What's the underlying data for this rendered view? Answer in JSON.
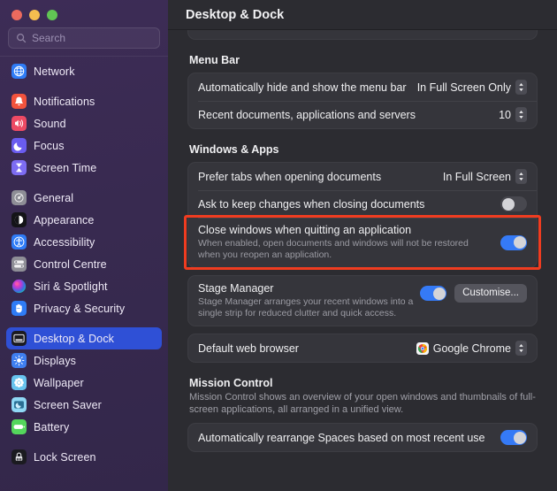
{
  "window": {
    "traffic_lights": [
      "close",
      "minimize",
      "maximize"
    ]
  },
  "sidebar": {
    "search": {
      "placeholder": "Search",
      "value": "",
      "icon": "search-icon"
    },
    "groups": [
      {
        "items": [
          {
            "label": "Network",
            "icon": "network-globe-icon",
            "selected": false
          }
        ]
      },
      {
        "items": [
          {
            "label": "Notifications",
            "icon": "notifications-bell-icon",
            "selected": false
          },
          {
            "label": "Sound",
            "icon": "sound-speaker-icon",
            "selected": false
          },
          {
            "label": "Focus",
            "icon": "focus-moon-icon",
            "selected": false
          },
          {
            "label": "Screen Time",
            "icon": "screen-time-hourglass-icon",
            "selected": false
          }
        ]
      },
      {
        "items": [
          {
            "label": "General",
            "icon": "general-gear-icon",
            "selected": false
          },
          {
            "label": "Appearance",
            "icon": "appearance-contrast-icon",
            "selected": false
          },
          {
            "label": "Accessibility",
            "icon": "accessibility-person-icon",
            "selected": false
          },
          {
            "label": "Control Centre",
            "icon": "control-centre-switches-icon",
            "selected": false
          },
          {
            "label": "Siri & Spotlight",
            "icon": "siri-orb-icon",
            "selected": false
          },
          {
            "label": "Privacy & Security",
            "icon": "privacy-hand-icon",
            "selected": false
          }
        ]
      },
      {
        "items": [
          {
            "label": "Desktop & Dock",
            "icon": "desktop-dock-icon",
            "selected": true
          },
          {
            "label": "Displays",
            "icon": "displays-brightness-icon",
            "selected": false
          },
          {
            "label": "Wallpaper",
            "icon": "wallpaper-flower-icon",
            "selected": false
          },
          {
            "label": "Screen Saver",
            "icon": "screen-saver-icon",
            "selected": false
          },
          {
            "label": "Battery",
            "icon": "battery-icon",
            "selected": false
          }
        ]
      },
      {
        "items": [
          {
            "label": "Lock Screen",
            "icon": "lock-screen-icon",
            "selected": false
          }
        ]
      }
    ]
  },
  "header": {
    "title": "Desktop & Dock"
  },
  "sections": {
    "menu_bar": {
      "heading": "Menu Bar",
      "rows": [
        {
          "label": "Automatically hide and show the menu bar",
          "value": "In Full Screen Only",
          "control": "popup"
        },
        {
          "label": "Recent documents, applications and servers",
          "value": "10",
          "control": "stepper"
        }
      ]
    },
    "windows_apps": {
      "heading": "Windows & Apps",
      "rows": [
        {
          "label": "Prefer tabs when opening documents",
          "value": "In Full Screen",
          "control": "popup"
        },
        {
          "label": "Ask to keep changes when closing documents",
          "control": "toggle",
          "state": "off"
        },
        {
          "label": "Close windows when quitting an application",
          "sub": "When enabled, open documents and windows will not be restored when you reopen an application.",
          "control": "toggle",
          "state": "on",
          "highlighted": true
        }
      ],
      "stage_manager": {
        "label": "Stage Manager",
        "sub": "Stage Manager arranges your recent windows into a single strip for reduced clutter and quick access.",
        "state": "on",
        "button": "Customise..."
      },
      "default_browser": {
        "label": "Default web browser",
        "value": "Google Chrome",
        "icon": "google-chrome-icon",
        "control": "popup"
      }
    },
    "mission_control": {
      "heading": "Mission Control",
      "desc": "Mission Control shows an overview of your open windows and thumbnails of full-screen applications, all arranged in a unified view.",
      "rows": [
        {
          "label": "Automatically rearrange Spaces based on most recent use",
          "control": "toggle",
          "state": "on"
        }
      ]
    }
  },
  "colors": {
    "accent_blue": "#357af6",
    "selection_blue": "#2f50d6",
    "highlight_red": "#f03c20",
    "sidebar_purple": "#382a50",
    "content_bg": "#2c2c31",
    "card_bg": "#35353b"
  }
}
